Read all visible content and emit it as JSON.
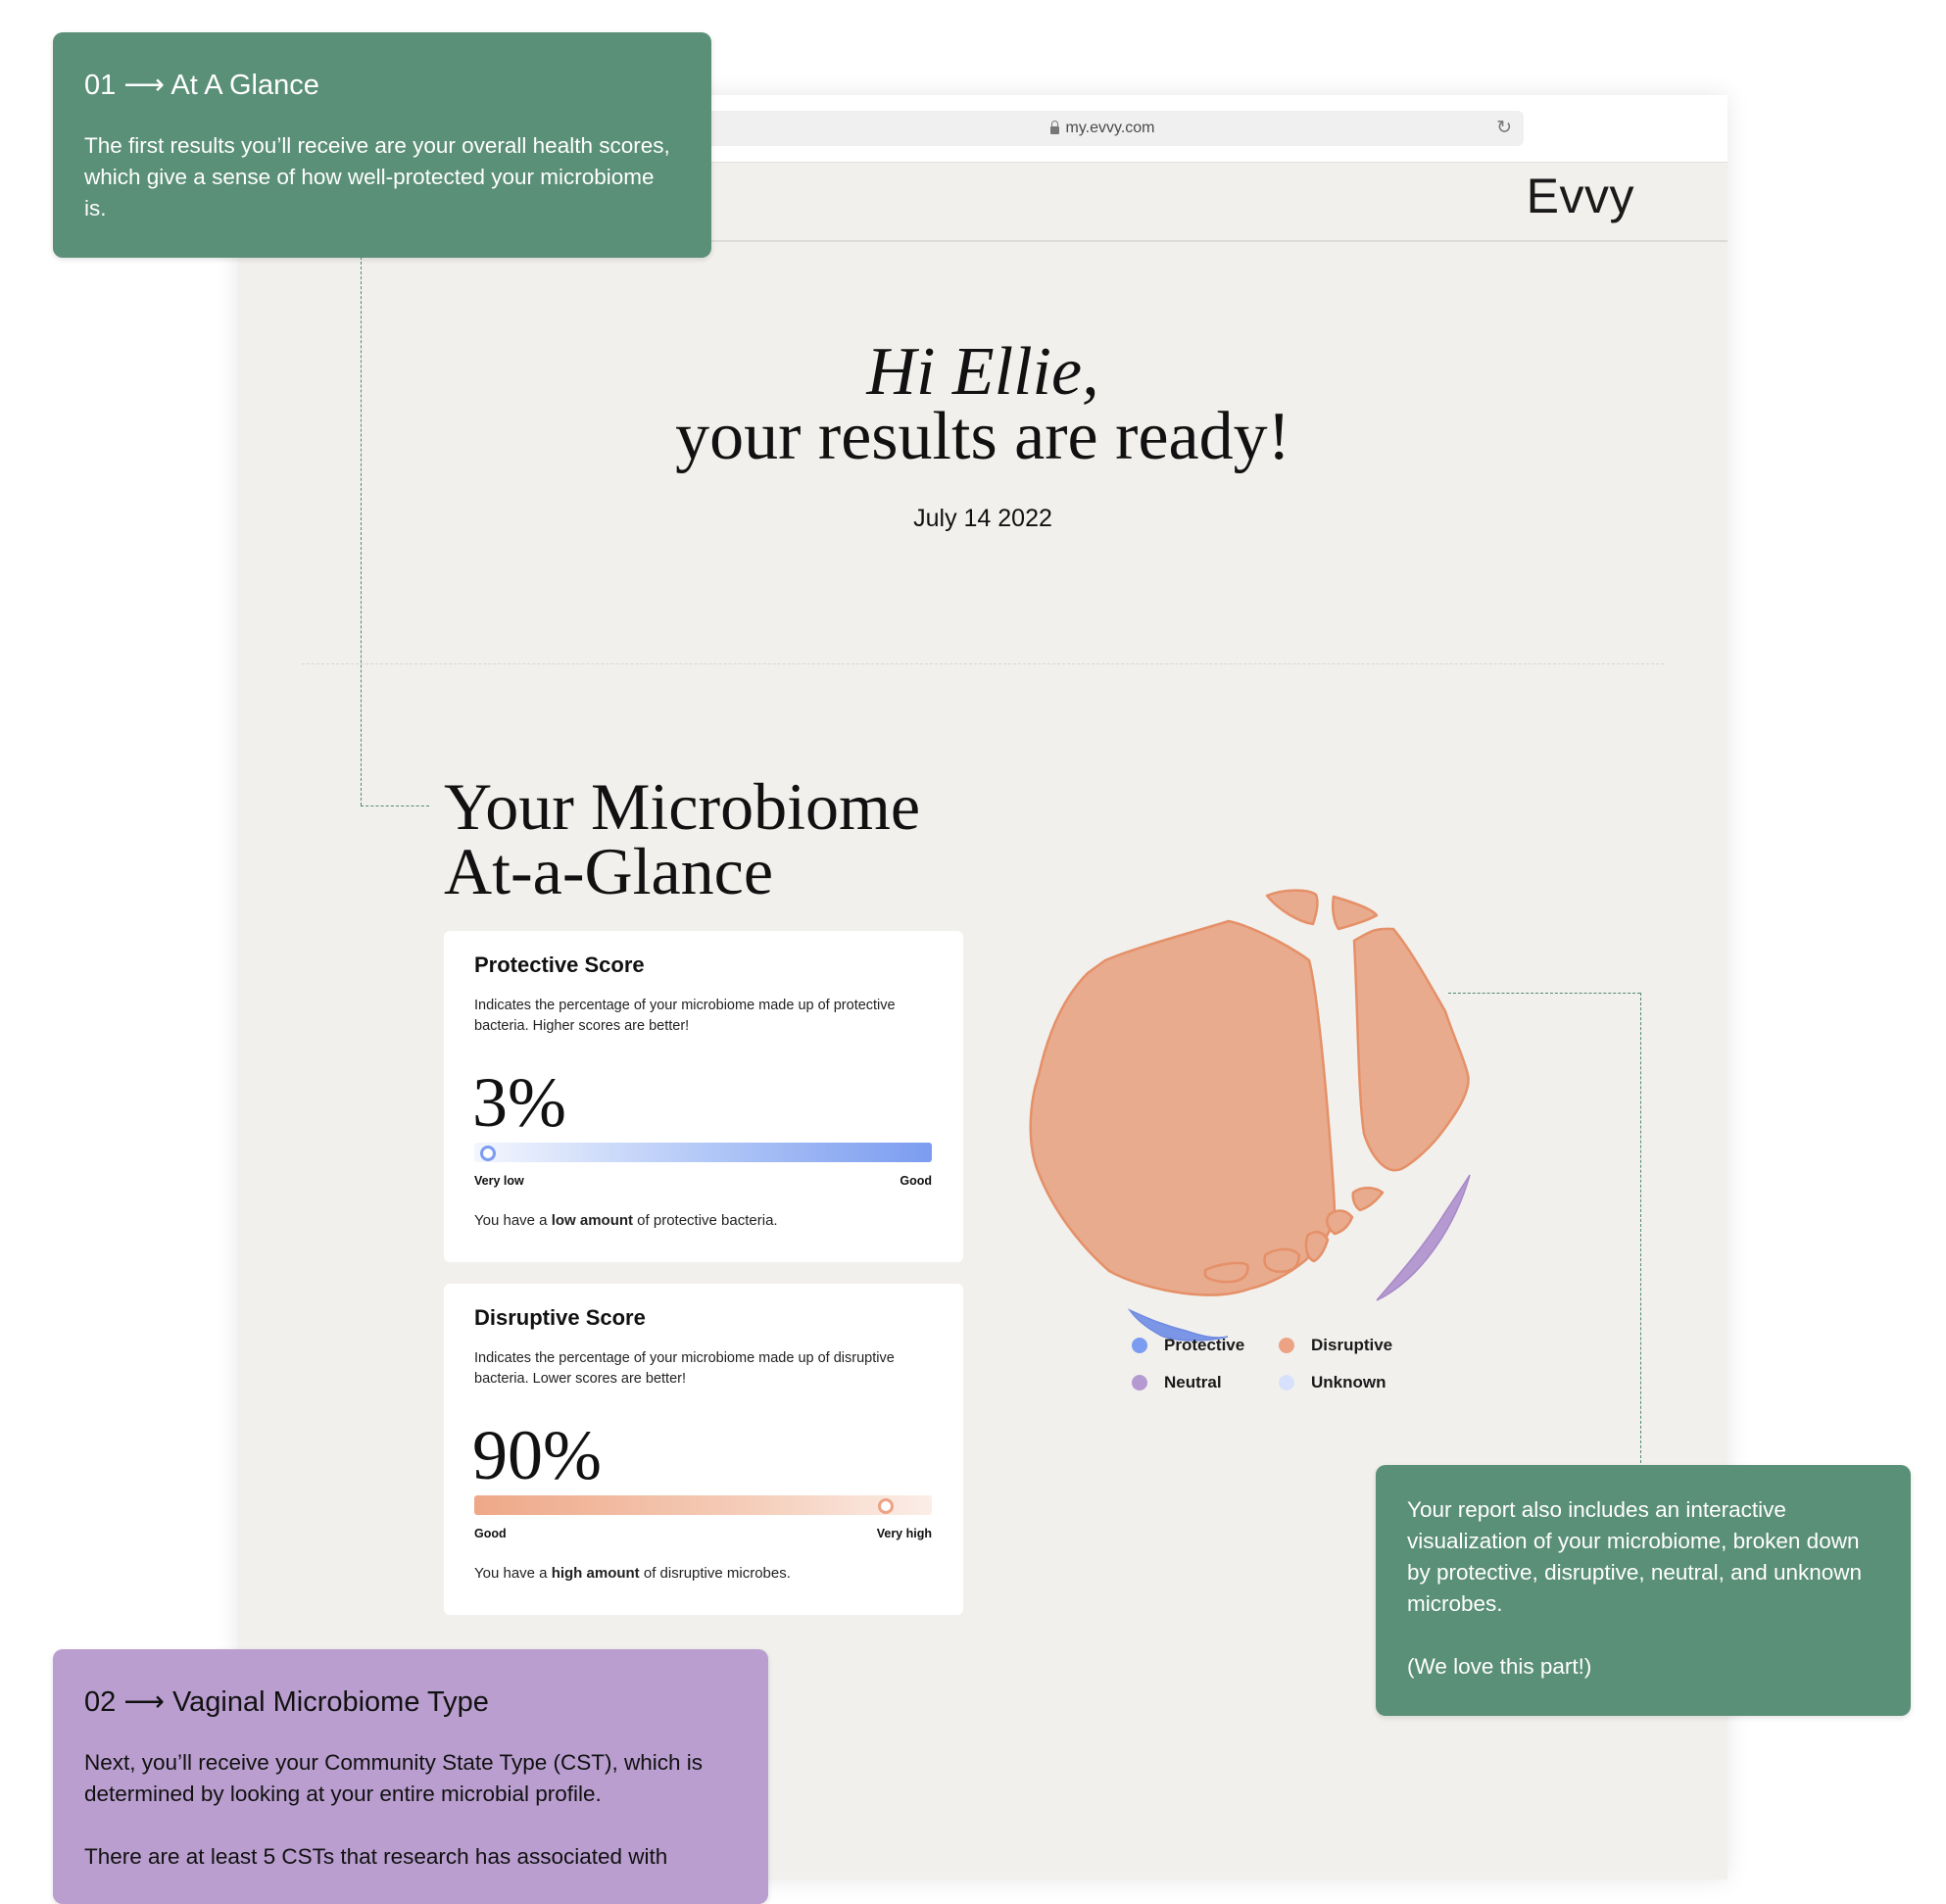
{
  "browser": {
    "url": "my.evvy.com",
    "brand": "Evvy"
  },
  "hero": {
    "greeting": "Hi Ellie,",
    "headline": "your results are ready!",
    "date": "July 14 2022"
  },
  "section": {
    "title_line1": "Your Microbiome",
    "title_line2": "At-a-Glance"
  },
  "protective": {
    "title": "Protective Score",
    "description": "Indicates the percentage of your microbiome made up of protective bacteria. Higher scores are better!",
    "value": "3%",
    "level": 0.03,
    "low_label": "Very low",
    "high_label": "Good",
    "note_prefix": "You have a ",
    "note_bold": "low amount",
    "note_suffix": " of protective bacteria."
  },
  "disruptive": {
    "title": "Disruptive Score",
    "description": "Indicates the percentage of your microbiome made up of disruptive bacteria. Lower scores are better!",
    "value": "90%",
    "level": 0.9,
    "low_label": "Good",
    "high_label": "Very high",
    "note_prefix": "You have a ",
    "note_bold": "high amount",
    "note_suffix": " of disruptive microbes."
  },
  "legend": [
    {
      "label": "Protective",
      "color": "#7b9cf0"
    },
    {
      "label": "Disruptive",
      "color": "#eca383"
    },
    {
      "label": "Neutral",
      "color": "#b59ad1"
    },
    {
      "label": "Unknown",
      "color": "#d7e1fb"
    }
  ],
  "colors": {
    "callout_green": "#5a8f78",
    "callout_purple": "#b99ecf",
    "disruptive_fill": "#e8ab8d",
    "disruptive_stroke": "#e59068",
    "protective_fill": "#7b96e6",
    "neutral_fill": "#b59ad1"
  },
  "callouts": {
    "glance": {
      "heading": "01 ⟶ At A Glance",
      "body": "The first results you’ll receive are your overall health scores, which give a sense of how well-protected your microbiome is."
    },
    "visual": {
      "body1": "Your report also includes an interactive visualization of your microbiome, broken down by protective, disruptive, neutral, and unknown microbes.",
      "body2": "(We love this part!)"
    },
    "cst": {
      "heading": "02 ⟶ Vaginal Microbiome Type",
      "body1": "Next, you’ll receive your Community State Type (CST), which is determined by looking at your entire microbial profile.",
      "body2": "There are at least 5 CSTs that research has associated with"
    }
  }
}
